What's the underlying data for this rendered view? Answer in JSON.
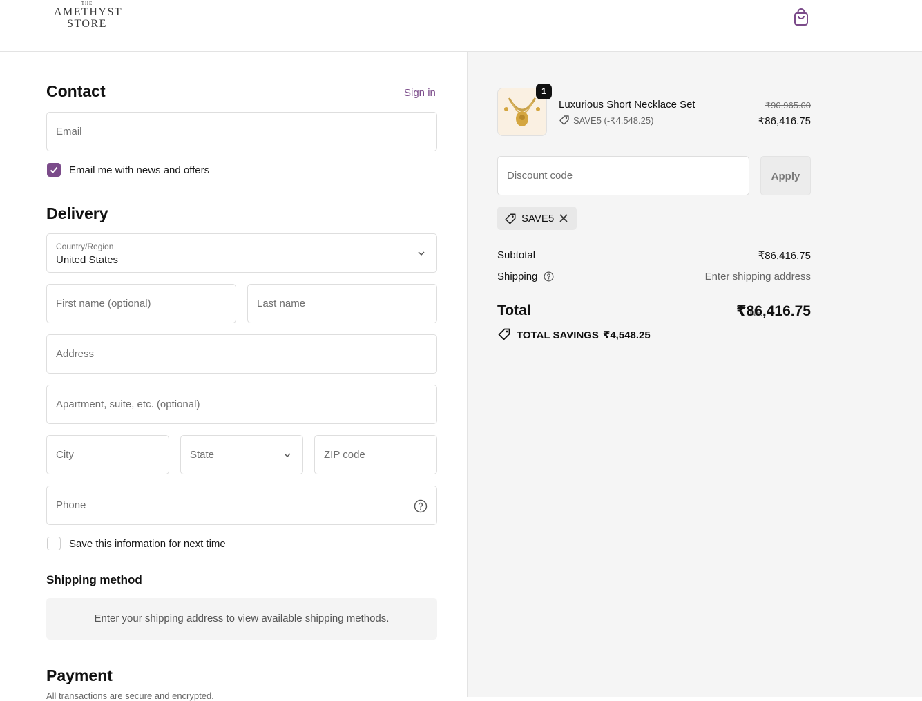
{
  "header": {
    "logo": {
      "the": "THE",
      "line1": "AMETHYST",
      "line2": "STORE"
    },
    "cart_icon": "shopping-bag-icon"
  },
  "contact": {
    "heading": "Contact",
    "sign_in": "Sign in",
    "email_placeholder": "Email",
    "news_offers_label": "Email me with news and offers",
    "news_offers_checked": true
  },
  "delivery": {
    "heading": "Delivery",
    "country_label": "Country/Region",
    "country_value": "United States",
    "first_name_placeholder": "First name (optional)",
    "last_name_placeholder": "Last name",
    "address_placeholder": "Address",
    "apartment_placeholder": "Apartment, suite, etc. (optional)",
    "city_placeholder": "City",
    "state_placeholder": "State",
    "zip_placeholder": "ZIP code",
    "phone_placeholder": "Phone",
    "save_info_label": "Save this information for next time",
    "save_info_checked": false
  },
  "shipping_method": {
    "heading": "Shipping method",
    "message": "Enter your shipping address to view available shipping methods."
  },
  "payment": {
    "heading": "Payment",
    "subtext": "All transactions are secure and encrypted."
  },
  "summary": {
    "product": {
      "name": "Luxurious Short Necklace Set",
      "quantity": "1",
      "discount": "SAVE5 (-₹4,548.25)",
      "original_price": "₹90,965.00",
      "price": "₹86,416.75"
    },
    "discount_placeholder": "Discount code",
    "apply_label": "Apply",
    "applied_code": "SAVE5",
    "subtotal_label": "Subtotal",
    "subtotal_value": "₹86,416.75",
    "shipping_label": "Shipping",
    "shipping_value": "Enter shipping address",
    "total_label": "Total",
    "total_currency": "INR",
    "total_value": "₹86,416.75",
    "savings_label": "TOTAL SAVINGS",
    "savings_value": "₹4,548.25"
  },
  "colors": {
    "accent": "#7b4b8a",
    "summary_bg": "#f5f5f5"
  }
}
